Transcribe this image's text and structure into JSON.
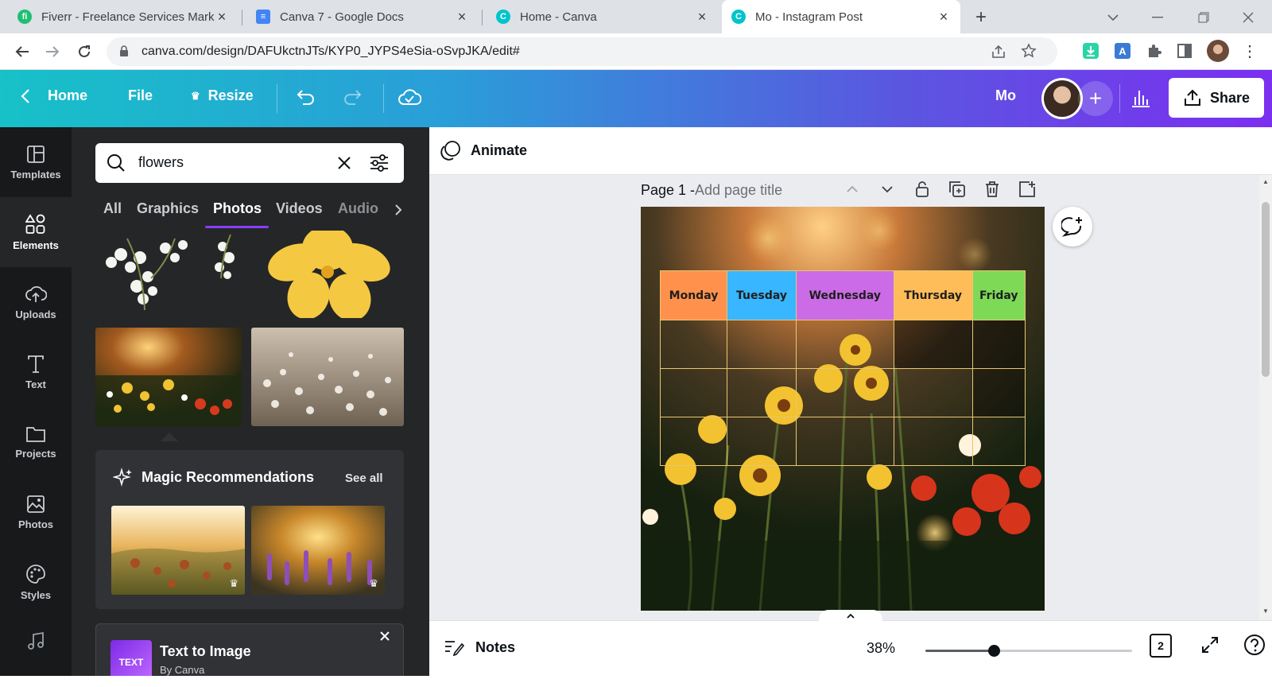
{
  "browser": {
    "tabs": [
      {
        "title": "Fiverr - Freelance Services Marke",
        "favicon": "fiverr-icon",
        "color": "#1dbf73"
      },
      {
        "title": "Canva 7 - Google Docs",
        "favicon": "docs-icon",
        "color": "#4285f4"
      },
      {
        "title": "Home - Canva",
        "favicon": "canva-icon",
        "color": "#00c4cc"
      },
      {
        "title": "Mo - Instagram Post",
        "favicon": "canva-icon",
        "color": "#00c4cc"
      }
    ],
    "url": "canva.com/design/DAFUkctnJTs/KYP0_JYPS4eSia-oSvpJKA/edit#"
  },
  "header": {
    "home": "Home",
    "file": "File",
    "resize": "Resize",
    "design_name": "Mo",
    "share": "Share"
  },
  "rail": {
    "items": [
      {
        "label": "Templates",
        "icon": "templates-icon"
      },
      {
        "label": "Elements",
        "icon": "elements-icon"
      },
      {
        "label": "Uploads",
        "icon": "upload-icon"
      },
      {
        "label": "Text",
        "icon": "text-icon"
      },
      {
        "label": "Projects",
        "icon": "folder-icon"
      },
      {
        "label": "Photos",
        "icon": "photos-icon"
      },
      {
        "label": "Styles",
        "icon": "styles-icon"
      }
    ]
  },
  "panel": {
    "search_value": "flowers",
    "categories": [
      "All",
      "Graphics",
      "Photos",
      "Videos",
      "Audio"
    ],
    "active_category": "Photos",
    "magic_title": "Magic Recommendations",
    "see_all": "See all",
    "tti_title": "Text to Image",
    "tti_by": "By Canva"
  },
  "editor": {
    "animate": "Animate",
    "page_label": "Page 1 -",
    "page_title_placeholder": "Add page title",
    "schedule_days": [
      "Monday",
      "Tuesday",
      "Wednesday",
      "Thursday",
      "Friday"
    ],
    "day_colors": [
      "#ff914d",
      "#38b6ff",
      "#cb6ce6",
      "#ffbd59",
      "#7ed957"
    ]
  },
  "footer": {
    "notes": "Notes",
    "zoom": "38%",
    "zoom_fraction": 0.33,
    "pages": "2"
  }
}
